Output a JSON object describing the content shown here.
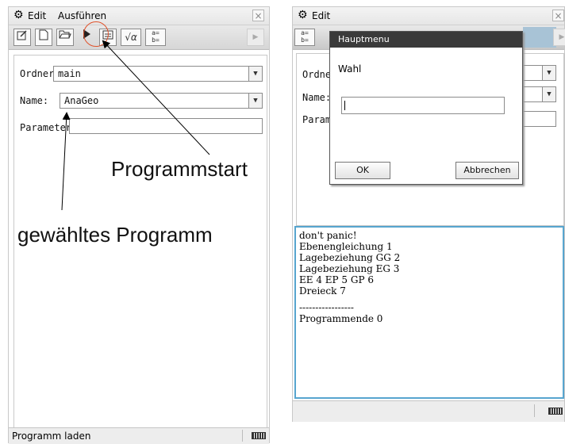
{
  "left_screen": {
    "menu": {
      "gear_icon": "gear-icon",
      "edit": "Edit",
      "run": "Ausführen"
    },
    "toolbar": {
      "buttons": [
        "edit-icon",
        "new-file-icon",
        "open-folder-icon",
        "run-icon",
        "text-icon",
        "sqrt-alpha-icon",
        "assign-icon"
      ],
      "sqrt_label": "√α",
      "assign_label": "a=\nb="
    },
    "form": {
      "folder_label": "Ordner:",
      "folder_value": "main",
      "name_label": "Name:",
      "name_value": "AnaGeo",
      "parameter_label": "Parameter:",
      "parameter_value": ""
    },
    "status": {
      "text": "Programm laden"
    }
  },
  "annotations": {
    "program_start": "Programmstart",
    "selected_program": "gewähltes Programm",
    "highlight_color": "#e0522b"
  },
  "right_screen": {
    "menu": {
      "edit": "Edit"
    },
    "toolbar": {
      "assign_label": "a=\nb="
    },
    "form": {
      "folder_label": "Ordner",
      "name_label": "Name:",
      "parameter_label": "Param"
    },
    "dialog": {
      "title": "Hauptmenu",
      "prompt": "Wahl",
      "input_value": "",
      "ok": "OK",
      "cancel": "Abbrechen"
    },
    "output_lines": [
      "don't panic!",
      "Ebenengleichung 1",
      "Lagebeziehung GG 2",
      "Lagebeziehung EG 3",
      "EE 4 EP 5 GP 6",
      "Dreieck 7",
      "",
      "-----------------",
      "Programmende 0"
    ],
    "output_border_color": "#57a5cf"
  }
}
